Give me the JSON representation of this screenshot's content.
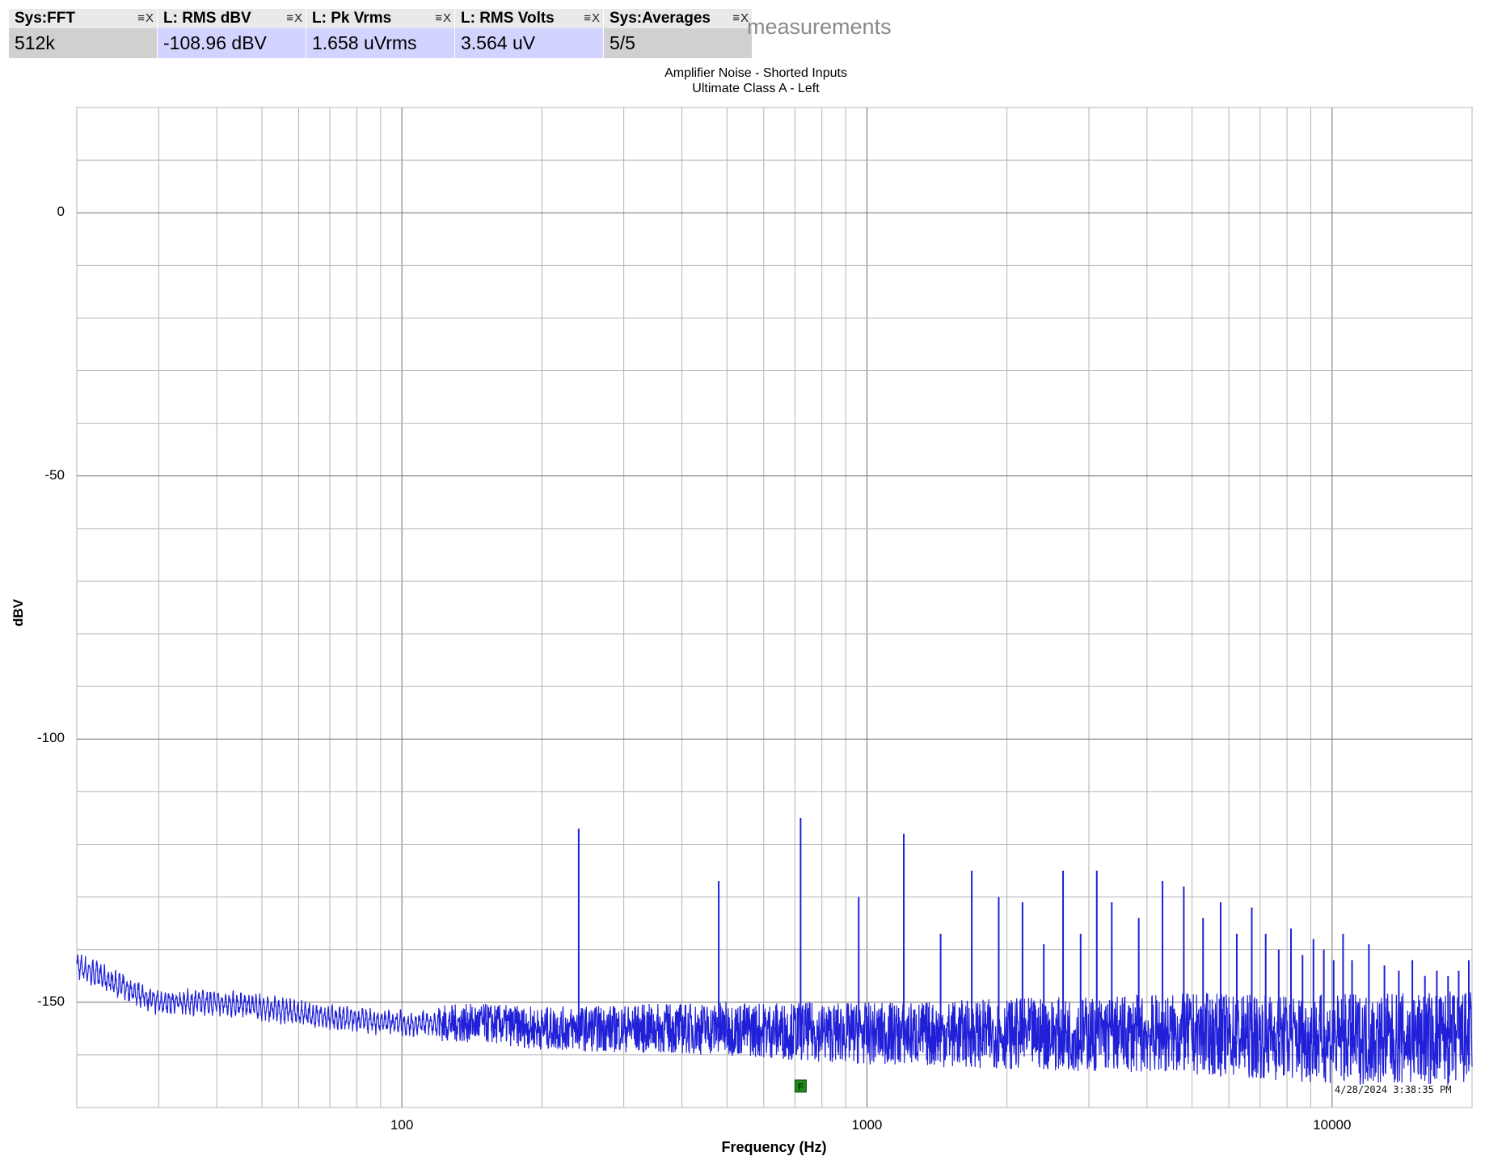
{
  "meters": [
    {
      "title": "Sys:FFT",
      "value": "512k",
      "kind": "sys"
    },
    {
      "title": "L: RMS dBV",
      "value": "-108.96 dBV",
      "kind": "ch"
    },
    {
      "title": "L: Pk Vrms",
      "value": "1.658 uVrms",
      "kind": "ch"
    },
    {
      "title": "L: RMS Volts",
      "value": "3.564 uV",
      "kind": "ch"
    },
    {
      "title": "Sys:Averages",
      "value": "5/5",
      "kind": "sys"
    }
  ],
  "meter_controls": "≡X",
  "brand_text": "measurements",
  "timestamp": "4/28/2024 3:38:35 PM",
  "colors": {
    "trace": "#2020d8",
    "grid": "#b4b4b4",
    "grid_major": "#6e6e6e",
    "marker": "#1a8a1a"
  },
  "chart_data": {
    "type": "line",
    "title": "Amplifier Noise - Shorted Inputs",
    "subtitle": "Ultimate Class A - Left",
    "xlabel": "Frequency (Hz)",
    "ylabel": "dBV",
    "x_scale": "log",
    "xlim": [
      20,
      20000
    ],
    "ylim": [
      -170,
      20
    ],
    "x_ticks": [
      100,
      1000,
      10000
    ],
    "y_ticks": [
      0,
      -50,
      -100,
      -150
    ],
    "grid": true,
    "series": [
      {
        "floor": [
          [
            20,
            -143
          ],
          [
            25,
            -147
          ],
          [
            30,
            -150
          ],
          [
            40,
            -150
          ],
          [
            50,
            -151
          ],
          [
            70,
            -153
          ],
          [
            100,
            -154
          ],
          [
            150,
            -154
          ],
          [
            200,
            -155
          ],
          [
            300,
            -155
          ],
          [
            500,
            -155
          ],
          [
            1000,
            -156
          ],
          [
            2000,
            -156
          ],
          [
            5000,
            -156
          ],
          [
            10000,
            -157
          ],
          [
            20000,
            -157
          ]
        ],
        "spikes": [
          [
            240,
            -117
          ],
          [
            480,
            -127
          ],
          [
            720,
            -115
          ],
          [
            960,
            -130
          ],
          [
            1200,
            -118
          ],
          [
            1440,
            -137
          ],
          [
            1680,
            -125
          ],
          [
            1920,
            -130
          ],
          [
            2160,
            -131
          ],
          [
            2400,
            -139
          ],
          [
            2640,
            -125
          ],
          [
            2880,
            -137
          ],
          [
            3120,
            -125
          ],
          [
            3360,
            -131
          ],
          [
            3840,
            -134
          ],
          [
            4320,
            -127
          ],
          [
            4800,
            -128
          ],
          [
            5280,
            -134
          ],
          [
            5760,
            -131
          ],
          [
            6240,
            -137
          ],
          [
            6720,
            -132
          ],
          [
            7200,
            -137
          ],
          [
            7680,
            -140
          ],
          [
            8160,
            -136
          ],
          [
            8640,
            -141
          ],
          [
            9120,
            -138
          ],
          [
            9600,
            -140
          ],
          [
            10080,
            -142
          ],
          [
            10560,
            -137
          ],
          [
            11040,
            -142
          ],
          [
            12000,
            -139
          ],
          [
            12960,
            -143
          ],
          [
            13920,
            -144
          ],
          [
            14880,
            -142
          ],
          [
            15840,
            -145
          ],
          [
            16800,
            -144
          ],
          [
            17760,
            -145
          ],
          [
            18720,
            -144
          ],
          [
            19680,
            -142
          ]
        ]
      }
    ],
    "marker": {
      "x": 720,
      "y": -166,
      "label": "F"
    }
  }
}
